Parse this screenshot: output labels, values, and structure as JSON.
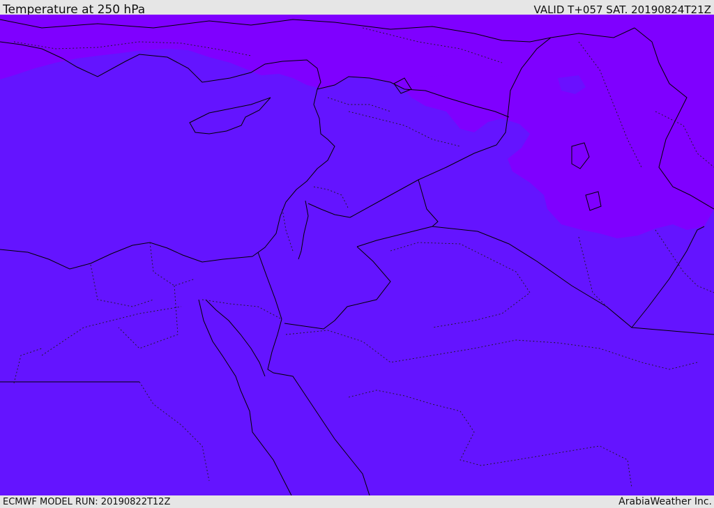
{
  "header": {
    "title": "Temperature at 250 hPa",
    "valid": "VALID T+057 SAT. 20190824T21Z"
  },
  "footer": {
    "model_run": "ECMWF MODEL RUN: 20190822T12Z",
    "credit": "ArabiaWeather Inc."
  },
  "map": {
    "field": "temperature-250hPa",
    "fill_colors": {
      "cold_band": "#7f00ff",
      "base": "#6414ff"
    },
    "line_colors": {
      "coastline": "#000000",
      "border": "#000000",
      "admin_boundary": "#1a1a1a"
    }
  }
}
